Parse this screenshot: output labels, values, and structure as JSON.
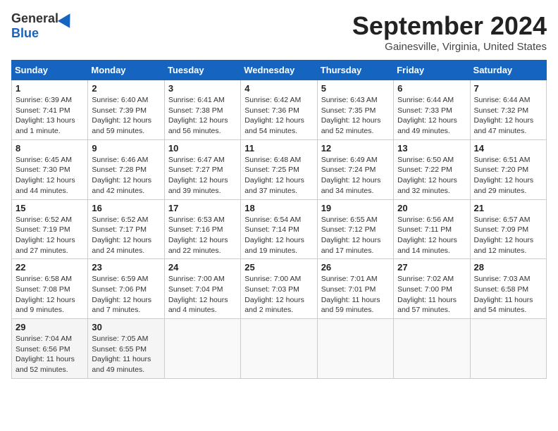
{
  "header": {
    "logo_general": "General",
    "logo_blue": "Blue",
    "month_title": "September 2024",
    "subtitle": "Gainesville, Virginia, United States"
  },
  "days_of_week": [
    "Sunday",
    "Monday",
    "Tuesday",
    "Wednesday",
    "Thursday",
    "Friday",
    "Saturday"
  ],
  "weeks": [
    [
      {
        "day": "1",
        "sunrise": "6:39 AM",
        "sunset": "7:41 PM",
        "daylight": "13 hours and 1 minute."
      },
      {
        "day": "2",
        "sunrise": "6:40 AM",
        "sunset": "7:39 PM",
        "daylight": "12 hours and 59 minutes."
      },
      {
        "day": "3",
        "sunrise": "6:41 AM",
        "sunset": "7:38 PM",
        "daylight": "12 hours and 56 minutes."
      },
      {
        "day": "4",
        "sunrise": "6:42 AM",
        "sunset": "7:36 PM",
        "daylight": "12 hours and 54 minutes."
      },
      {
        "day": "5",
        "sunrise": "6:43 AM",
        "sunset": "7:35 PM",
        "daylight": "12 hours and 52 minutes."
      },
      {
        "day": "6",
        "sunrise": "6:44 AM",
        "sunset": "7:33 PM",
        "daylight": "12 hours and 49 minutes."
      },
      {
        "day": "7",
        "sunrise": "6:44 AM",
        "sunset": "7:32 PM",
        "daylight": "12 hours and 47 minutes."
      }
    ],
    [
      {
        "day": "8",
        "sunrise": "6:45 AM",
        "sunset": "7:30 PM",
        "daylight": "12 hours and 44 minutes."
      },
      {
        "day": "9",
        "sunrise": "6:46 AM",
        "sunset": "7:28 PM",
        "daylight": "12 hours and 42 minutes."
      },
      {
        "day": "10",
        "sunrise": "6:47 AM",
        "sunset": "7:27 PM",
        "daylight": "12 hours and 39 minutes."
      },
      {
        "day": "11",
        "sunrise": "6:48 AM",
        "sunset": "7:25 PM",
        "daylight": "12 hours and 37 minutes."
      },
      {
        "day": "12",
        "sunrise": "6:49 AM",
        "sunset": "7:24 PM",
        "daylight": "12 hours and 34 minutes."
      },
      {
        "day": "13",
        "sunrise": "6:50 AM",
        "sunset": "7:22 PM",
        "daylight": "12 hours and 32 minutes."
      },
      {
        "day": "14",
        "sunrise": "6:51 AM",
        "sunset": "7:20 PM",
        "daylight": "12 hours and 29 minutes."
      }
    ],
    [
      {
        "day": "15",
        "sunrise": "6:52 AM",
        "sunset": "7:19 PM",
        "daylight": "12 hours and 27 minutes."
      },
      {
        "day": "16",
        "sunrise": "6:52 AM",
        "sunset": "7:17 PM",
        "daylight": "12 hours and 24 minutes."
      },
      {
        "day": "17",
        "sunrise": "6:53 AM",
        "sunset": "7:16 PM",
        "daylight": "12 hours and 22 minutes."
      },
      {
        "day": "18",
        "sunrise": "6:54 AM",
        "sunset": "7:14 PM",
        "daylight": "12 hours and 19 minutes."
      },
      {
        "day": "19",
        "sunrise": "6:55 AM",
        "sunset": "7:12 PM",
        "daylight": "12 hours and 17 minutes."
      },
      {
        "day": "20",
        "sunrise": "6:56 AM",
        "sunset": "7:11 PM",
        "daylight": "12 hours and 14 minutes."
      },
      {
        "day": "21",
        "sunrise": "6:57 AM",
        "sunset": "7:09 PM",
        "daylight": "12 hours and 12 minutes."
      }
    ],
    [
      {
        "day": "22",
        "sunrise": "6:58 AM",
        "sunset": "7:08 PM",
        "daylight": "12 hours and 9 minutes."
      },
      {
        "day": "23",
        "sunrise": "6:59 AM",
        "sunset": "7:06 PM",
        "daylight": "12 hours and 7 minutes."
      },
      {
        "day": "24",
        "sunrise": "7:00 AM",
        "sunset": "7:04 PM",
        "daylight": "12 hours and 4 minutes."
      },
      {
        "day": "25",
        "sunrise": "7:00 AM",
        "sunset": "7:03 PM",
        "daylight": "12 hours and 2 minutes."
      },
      {
        "day": "26",
        "sunrise": "7:01 AM",
        "sunset": "7:01 PM",
        "daylight": "11 hours and 59 minutes."
      },
      {
        "day": "27",
        "sunrise": "7:02 AM",
        "sunset": "7:00 PM",
        "daylight": "11 hours and 57 minutes."
      },
      {
        "day": "28",
        "sunrise": "7:03 AM",
        "sunset": "6:58 PM",
        "daylight": "11 hours and 54 minutes."
      }
    ],
    [
      {
        "day": "29",
        "sunrise": "7:04 AM",
        "sunset": "6:56 PM",
        "daylight": "11 hours and 52 minutes."
      },
      {
        "day": "30",
        "sunrise": "7:05 AM",
        "sunset": "6:55 PM",
        "daylight": "11 hours and 49 minutes."
      },
      null,
      null,
      null,
      null,
      null
    ]
  ]
}
